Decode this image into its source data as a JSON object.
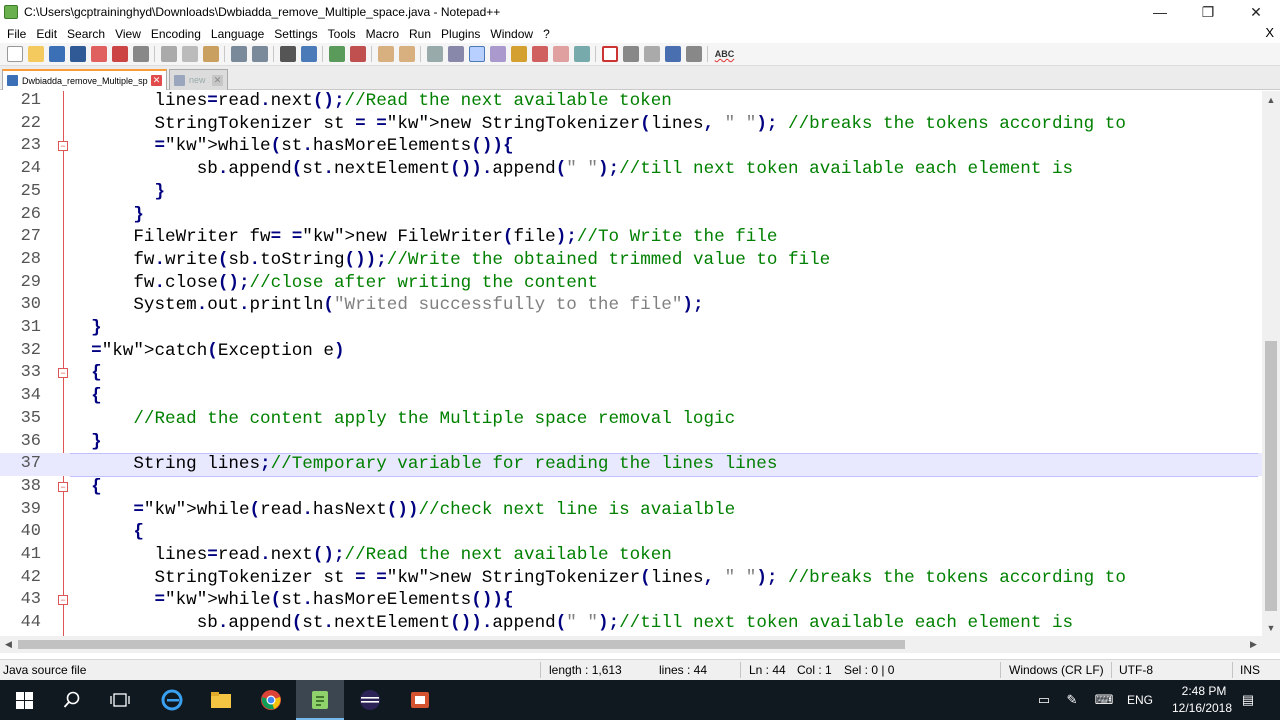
{
  "window": {
    "title": "C:\\Users\\gcptraininghyd\\Downloads\\Dwbiadda_remove_Multiple_space.java - Notepad++",
    "minimize": "—",
    "maximize": "❐",
    "close": "✕"
  },
  "menu": {
    "items": [
      "File",
      "Edit",
      "Search",
      "View",
      "Encoding",
      "Language",
      "Settings",
      "Tools",
      "Macro",
      "Run",
      "Plugins",
      "Window",
      "?"
    ],
    "close": "X"
  },
  "toolbar": {
    "spellcheck_label": "ABC"
  },
  "tabs": [
    {
      "label": "Dwbiadda_remove_Multiple_space.java",
      "close": "✕",
      "active": true
    },
    {
      "label": "new 1",
      "close": "✕",
      "active": false
    }
  ],
  "editor": {
    "lines": [
      {
        "n": "21",
        "text": "        lines=read.next();//Read the next available token"
      },
      {
        "n": "22",
        "text": "        StringTokenizer st = new StringTokenizer(lines, \" \"); //breaks the tokens according to"
      },
      {
        "n": "23",
        "text": "        while(st.hasMoreElements()){"
      },
      {
        "n": "24",
        "text": "            sb.append(st.nextElement()).append(\" \");//till next token available each element is"
      },
      {
        "n": "25",
        "text": "        }"
      },
      {
        "n": "26",
        "text": "      }"
      },
      {
        "n": "27",
        "text": "      FileWriter fw= new FileWriter(file);//To Write the file"
      },
      {
        "n": "28",
        "text": "      fw.write(sb.toString());//Write the obtained trimmed value to file"
      },
      {
        "n": "29",
        "text": "      fw.close();//close after writing the content"
      },
      {
        "n": "30",
        "text": "      System.out.println(\"Writed successfully to the file\");"
      },
      {
        "n": "31",
        "text": "  }"
      },
      {
        "n": "32",
        "text": "  catch(Exception e)"
      },
      {
        "n": "33",
        "text": "  {"
      },
      {
        "n": "34",
        "text": "  {"
      },
      {
        "n": "35",
        "text": "      //Read the content apply the Multiple space removal logic"
      },
      {
        "n": "36",
        "text": "  }"
      },
      {
        "n": "37",
        "text": "      String lines;//Temporary variable for reading the lines lines"
      },
      {
        "n": "38",
        "text": "  {"
      },
      {
        "n": "39",
        "text": "      while(read.hasNext())//check next line is avaialble"
      },
      {
        "n": "40",
        "text": "      {"
      },
      {
        "n": "41",
        "text": "        lines=read.next();//Read the next available token"
      },
      {
        "n": "42",
        "text": "        StringTokenizer st = new StringTokenizer(lines, \" \"); //breaks the tokens according to"
      },
      {
        "n": "43",
        "text": "        while(st.hasMoreElements()){"
      },
      {
        "n": "44",
        "text": "            sb.append(st.nextElement()).append(\" \");//till next token available each element is"
      }
    ]
  },
  "status": {
    "file_type": "Java source file",
    "length": "length : 1,613",
    "lines": "lines : 44",
    "ln": "Ln : 44",
    "col": "Col : 1",
    "sel": "Sel : 0 | 0",
    "eol": "Windows (CR LF)",
    "encoding": "UTF-8",
    "mode": "INS"
  },
  "taskbar": {
    "language": "ENG",
    "time": "2:48 PM",
    "date": "12/16/2018"
  },
  "colors": {
    "keyword": "#000080",
    "comment": "#008000",
    "string": "#808080",
    "fold": "#dd5555",
    "tab_accent": "#fa9d39"
  }
}
